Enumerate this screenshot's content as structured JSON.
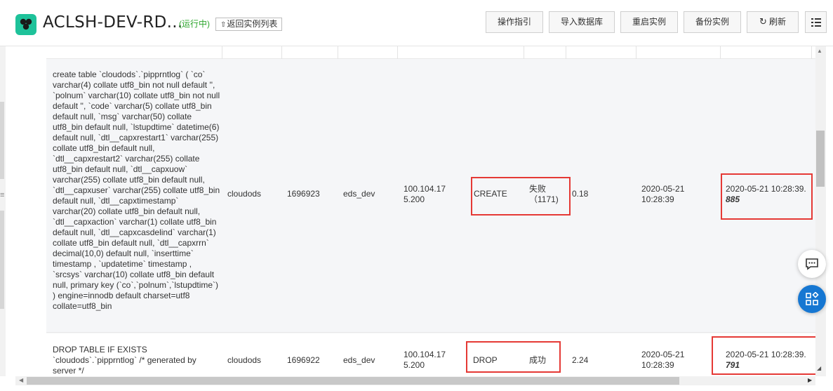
{
  "header": {
    "title": "ACLSH-DEV-RD...",
    "status": "(运行中)",
    "back_label": "返回实例列表",
    "buttons": {
      "guide": "操作指引",
      "import_db": "导入数据库",
      "restart": "重启实例",
      "backup": "备份实例",
      "refresh": "刷新"
    }
  },
  "icons": {
    "logo": "database-logo-icon",
    "back": "back-arrow-icon",
    "refresh": "refresh-icon",
    "menu": "list-menu-icon",
    "chat": "chat-icon",
    "apps": "apps-icon"
  },
  "colors": {
    "brand": "#1ec29a",
    "status": "#2aa52a",
    "highlight": "#e53935",
    "fab_blue": "#1677d2"
  },
  "rows": [
    {
      "sql": "create table `cloudods`.`pipprntlog` ( `co` varchar(4) collate utf8_bin not null default '', `polnum` varchar(10) collate utf8_bin not null default '', `code` varchar(5) collate utf8_bin default null, `msg` varchar(50) collate utf8_bin default null, `lstupdtime` datetime(6) default null, `dtl__capxrestart1` varchar(255) collate utf8_bin default null, `dtl__capxrestart2` varchar(255) collate utf8_bin default null, `dtl__capxuow` varchar(255) collate utf8_bin default null, `dtl__capxuser` varchar(255) collate utf8_bin default null, `dtl__capxtimestamp` varchar(20) collate utf8_bin default null, `dtl__capxaction` varchar(1) collate utf8_bin default null, `dtl__capxcasdelind` varchar(1) collate utf8_bin default null, `dtl__capxrrn` decimal(10,0) default null, `inserttime` timestamp , `updatetime` timestamp , `srcsys` varchar(10) collate utf8_bin default null, primary key (`co`,`polnum`,`lstupdtime`) ) engine=innodb default charset=utf8 collate=utf8_bin",
      "db": "cloudods",
      "id": "1696923",
      "user": "eds_dev",
      "ip": "100.104.175.200",
      "type": "CREATE",
      "result": "失败（1171)",
      "duration": "0.18",
      "start_time": "2020-05-21 10:28:39",
      "end_time": "2020-05-21 10:28:39.",
      "end_ms": "885"
    },
    {
      "sql": "DROP TABLE IF EXISTS `cloudods`.`pipprntlog` /* generated by server */",
      "db": "cloudods",
      "id": "1696922",
      "user": "eds_dev",
      "ip": "100.104.175.200",
      "type": "DROP",
      "result": "成功",
      "duration": "2.24",
      "start_time": "2020-05-21 10:28:39",
      "end_time": "2020-05-21 10:28:39.",
      "end_ms": "791"
    }
  ]
}
